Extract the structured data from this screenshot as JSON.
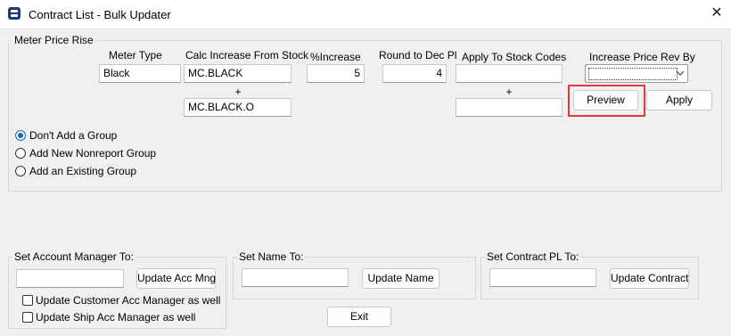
{
  "window": {
    "title": "Contract List - Bulk Updater"
  },
  "meter_price_rise": {
    "legend": "Meter Price Rise",
    "headers": {
      "meter_type": "Meter Type",
      "calc_increase": "Calc Increase From Stock",
      "pct_increase": "%Increase",
      "round_to": "Round to Dec Pl",
      "apply_to": "Apply To Stock Codes",
      "increase_price_rev": "Increase Price Rev By"
    },
    "meter_type_value": "Black",
    "calc_stock_1": "MC.BLACK",
    "calc_stock_2": "MC.BLACK.O",
    "plus": "+",
    "pct_increase_value": "5",
    "round_value": "4",
    "apply_stock_1": "",
    "apply_stock_2": "",
    "rev_by_value": "",
    "preview_label": "Preview",
    "apply_label": "Apply",
    "radios": [
      {
        "label": "Don't Add a Group",
        "selected": true
      },
      {
        "label": "Add New Nonreport Group",
        "selected": false
      },
      {
        "label": "Add an Existing Group",
        "selected": false
      }
    ]
  },
  "account_manager": {
    "legend": "Set Account Manager To:",
    "value": "",
    "button": "Update Acc Mng",
    "check_customer": "Update Customer Acc Manager as well",
    "check_ship": "Update Ship Acc Manager as well"
  },
  "set_name": {
    "legend": "Set Name To:",
    "value": "",
    "button": "Update Name"
  },
  "contract_pl": {
    "legend": "Set Contract PL To:",
    "value": "",
    "button": "Update Contract"
  },
  "exit_label": "Exit",
  "colors": {
    "highlight": "#e0393b",
    "radio_accent": "#1565c0",
    "app_icon": "#1f3b73"
  }
}
